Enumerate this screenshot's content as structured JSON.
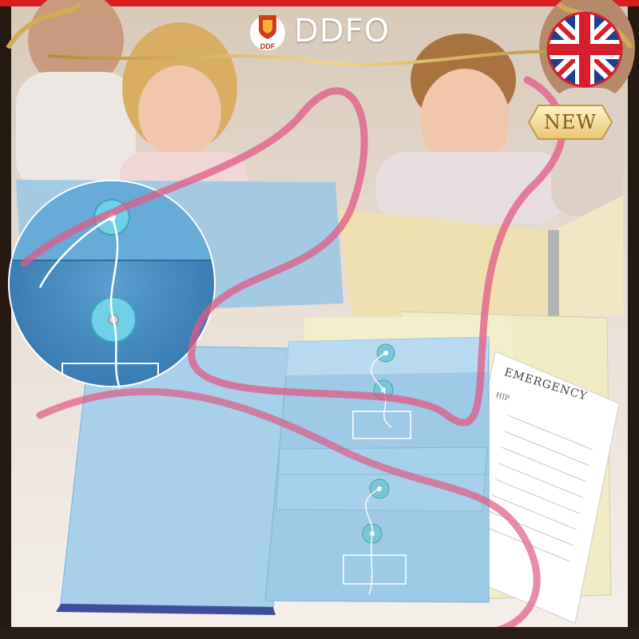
{
  "header": {
    "brand_name": "DDFO",
    "logo_caption": "DDF"
  },
  "badges": {
    "new_label": "NEW"
  },
  "product": {
    "document_heading": "EMERGENCY",
    "document_sub": "HIP"
  },
  "icons": [
    "brand-shield-icon",
    "uk-flag-icon"
  ],
  "colors": {
    "frame_top": "#d81e1e",
    "frame_gold": "#c9a24a",
    "folder_blue": "#8ec5e6",
    "ribbon_pink": "#e05a86",
    "envelope_cream": "#f2ecc0"
  }
}
